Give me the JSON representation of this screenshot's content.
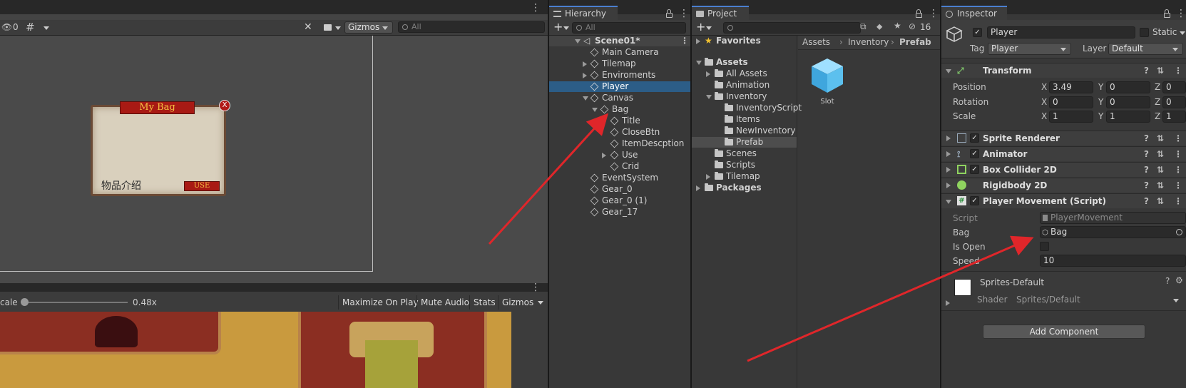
{
  "scene": {
    "toolbar": {
      "visibility_count": "0",
      "gizmos_label": "Gizmos",
      "search_placeholder": "All"
    },
    "bag_ui": {
      "title": "My Bag",
      "close": "X",
      "item_desc": "物品介绍",
      "use_label": "USE"
    }
  },
  "game": {
    "scale_label": "cale",
    "scale_value": "0.48x",
    "buttons": [
      "Maximize On Play",
      "Mute Audio",
      "Stats",
      "Gizmos"
    ]
  },
  "hierarchy": {
    "tab_label": "Hierarchy",
    "search_placeholder": "All",
    "scene_name": "Scene01*",
    "items": [
      {
        "label": "Main Camera"
      },
      {
        "label": "Tilemap"
      },
      {
        "label": "Enviroments"
      },
      {
        "label": "Player"
      },
      {
        "label": "Canvas"
      },
      {
        "label": "Bag"
      },
      {
        "label": "Title"
      },
      {
        "label": "CloseBtn"
      },
      {
        "label": "ItemDescption"
      },
      {
        "label": "Use"
      },
      {
        "label": "Crid"
      },
      {
        "label": "EventSystem"
      },
      {
        "label": "Gear_0"
      },
      {
        "label": "Gear_0 (1)"
      },
      {
        "label": "Gear_17"
      }
    ]
  },
  "project": {
    "tab_label": "Project",
    "hidden_count": "16",
    "breadcrumb": [
      "Assets",
      "Inventory",
      "Prefab"
    ],
    "tree": [
      {
        "label": "Favorites"
      },
      {
        "label": "Assets"
      },
      {
        "label": "All Assets"
      },
      {
        "label": "Animation"
      },
      {
        "label": "Inventory"
      },
      {
        "label": "InventoryScript"
      },
      {
        "label": "Items"
      },
      {
        "label": "NewInventory"
      },
      {
        "label": "Prefab"
      },
      {
        "label": "Scenes"
      },
      {
        "label": "Scripts"
      },
      {
        "label": "Tilemap"
      },
      {
        "label": "Packages"
      }
    ],
    "asset_label": "Slot"
  },
  "inspector": {
    "tab_label": "Inspector",
    "object_name": "Player",
    "static_label": "Static",
    "tag_label": "Tag",
    "tag_value": "Player",
    "layer_label": "Layer",
    "layer_value": "Default",
    "transform": {
      "title": "Transform",
      "position_label": "Position",
      "rotation_label": "Rotation",
      "scale_label": "Scale",
      "axis_x": "X",
      "axis_y": "Y",
      "axis_z": "Z",
      "position": [
        "3.49",
        "0",
        "0"
      ],
      "rotation": [
        "0",
        "0",
        "0"
      ],
      "scale": [
        "1",
        "1",
        "1"
      ]
    },
    "components": [
      "Sprite Renderer",
      "Animator",
      "Box Collider 2D",
      "Rigidbody 2D",
      "Player Movement (Script)"
    ],
    "script_props": {
      "script_label": "Script",
      "script_value": "PlayerMovement",
      "bag_label": "Bag",
      "bag_value": "Bag",
      "is_open_label": "Is Open",
      "speed_label": "Speed",
      "speed_value": "10"
    },
    "material": {
      "name": "Sprites-Default",
      "shader_label": "Shader",
      "shader_value": "Sprites/Default"
    },
    "add_component": "Add Component"
  },
  "colors": {
    "selection": "#2c5d87",
    "arrow": "#e0262a",
    "panel": "#383838"
  }
}
